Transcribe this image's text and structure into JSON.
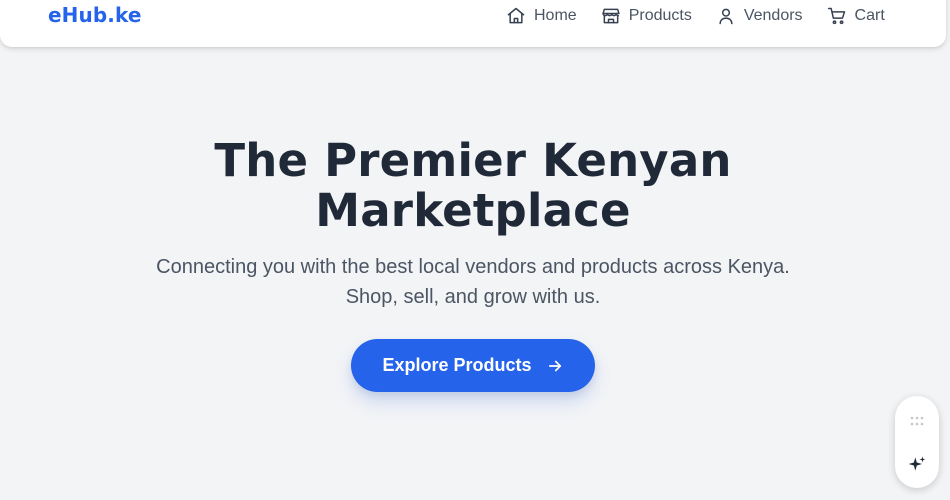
{
  "header": {
    "brand": "eHub.ke",
    "nav": [
      {
        "label": "Home",
        "icon": "home-icon"
      },
      {
        "label": "Products",
        "icon": "store-icon"
      },
      {
        "label": "Vendors",
        "icon": "user-icon"
      },
      {
        "label": "Cart",
        "icon": "cart-icon"
      }
    ]
  },
  "hero": {
    "title_line1": "The Premier Kenyan",
    "title_line2": "Marketplace",
    "subtitle_line1": "Connecting you with the best local vendors and products across Kenya.",
    "subtitle_line2": "Shop, sell, and grow with us.",
    "cta_label": "Explore Products",
    "cta_icon": "arrow-right-icon"
  },
  "widget": {
    "handle_icon": "drag-dots-icon",
    "action_icon": "sparkle-icon"
  },
  "colors": {
    "accent": "#2563eb",
    "background": "#f3f4f6",
    "heading": "#1f2937",
    "body_text": "#4b5563"
  }
}
